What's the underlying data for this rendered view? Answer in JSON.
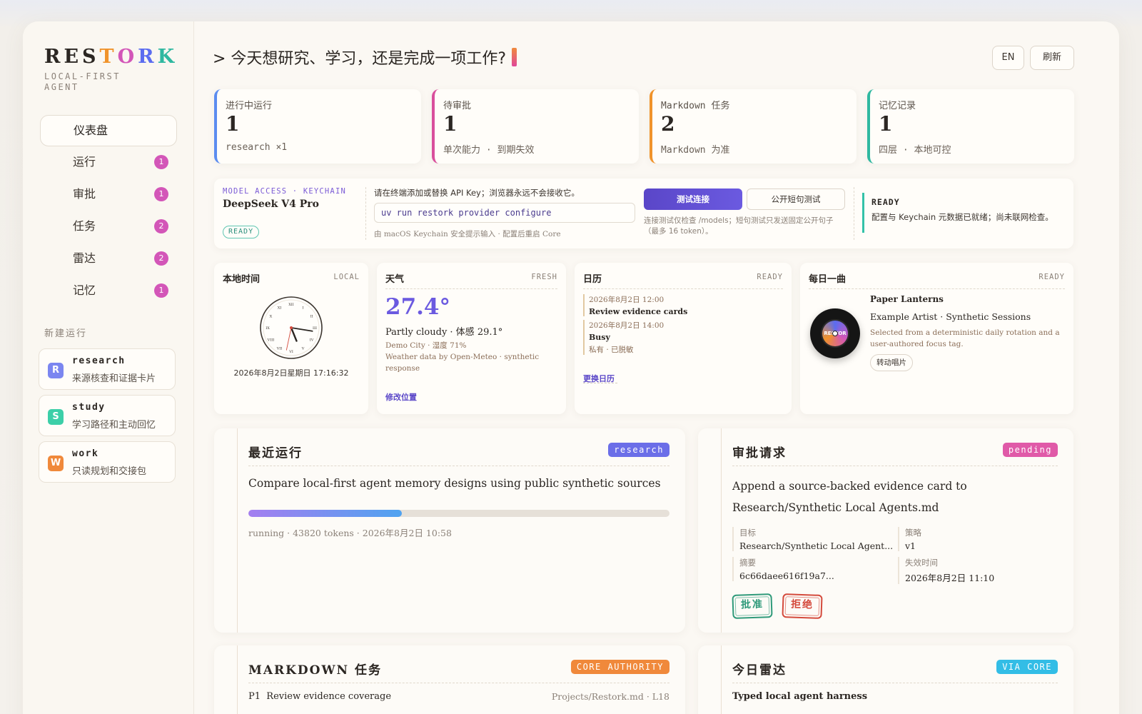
{
  "logo": {
    "letters": [
      {
        "ch": "R",
        "color": "#2b2622"
      },
      {
        "ch": "E",
        "color": "#2b2622"
      },
      {
        "ch": "S",
        "color": "#2b2622"
      },
      {
        "ch": "T",
        "color": "#f0932b"
      },
      {
        "ch": "O",
        "color": "#d356b8"
      },
      {
        "ch": "R",
        "color": "#5b6cf0"
      },
      {
        "ch": "K",
        "color": "#2fb8a0"
      }
    ],
    "tagline": "LOCAL-FIRST AGENT"
  },
  "nav": {
    "active": "仪表盘",
    "items": [
      {
        "label": "运行",
        "count": "1"
      },
      {
        "label": "审批",
        "count": "1"
      },
      {
        "label": "任务",
        "count": "2"
      },
      {
        "label": "雷达",
        "count": "2"
      },
      {
        "label": "记忆",
        "count": "1"
      }
    ]
  },
  "new_run": {
    "label": "新建运行",
    "items": [
      {
        "letter": "R",
        "name": "research",
        "desc": "来源核查和证据卡片",
        "color": "#7b86f0"
      },
      {
        "letter": "S",
        "name": "study",
        "desc": "学习路径和主动回忆",
        "color": "#3ccfa8"
      },
      {
        "letter": "W",
        "name": "work",
        "desc": "只读规划和交接包",
        "color": "#f0893b"
      }
    ]
  },
  "header": {
    "prompt": "> 今天想研究、学习，还是完成一项工作?",
    "lang_button": "EN",
    "refresh_button": "刷新"
  },
  "stats": [
    {
      "label": "进行中运行",
      "value": "1",
      "sub": "research ×1",
      "color": "#5b8cf0"
    },
    {
      "label": "待审批",
      "value": "1",
      "sub": "单次能力 · 到期失效",
      "color": "#d94f9c"
    },
    {
      "label": "Markdown 任务",
      "value": "2",
      "sub": "Markdown 为准",
      "color": "#f0932b"
    },
    {
      "label": "记忆记录",
      "value": "1",
      "sub": "四层 · 本地可控",
      "color": "#2fb8a0"
    }
  ],
  "model_access": {
    "kicker": "MODEL ACCESS · KEYCHAIN",
    "model": "DeepSeek V4 Pro",
    "badge": "READY",
    "instruction": "请在终端添加或替换 API Key；浏览器永远不会接收它。",
    "command": "uv run restork provider configure",
    "hint": "由 macOS Keychain 安全提示输入 · 配置后重启 Core",
    "test_button": "测试连接",
    "public_test_button": "公开短句测试",
    "test_note": "连接测试仅检查 /models；短句测试只发送固定公开句子（最多 16 token）。",
    "status_title": "READY",
    "status_text": "配置与 Keychain 元数据已就绪；尚未联网检查。"
  },
  "clock": {
    "title": "本地时间",
    "tag": "LOCAL",
    "datetime": "2026年8月2日星期日 17:16:32",
    "hour": 17,
    "minute": 16,
    "second": 32,
    "numerals": [
      "XII",
      "I",
      "II",
      "III",
      "IV",
      "V",
      "VI",
      "VII",
      "VIII",
      "IX",
      "X",
      "XI"
    ]
  },
  "weather": {
    "title": "天气",
    "tag": "FRESH",
    "temp": "27.4°",
    "summary": "Partly cloudy · 体感 29.1°",
    "location": "Demo City · 湿度 71%",
    "credit": "Weather data by Open-Meteo · synthetic response",
    "link": "修改位置"
  },
  "calendar": {
    "title": "日历",
    "tag": "READY",
    "events": [
      {
        "time": "2026年8月2日 12:00",
        "name": "Review evidence cards",
        "note": ""
      },
      {
        "time": "2026年8月2日 14:00",
        "name": "Busy",
        "note": "私有 · 已脱敏"
      }
    ],
    "link": "更换日历"
  },
  "song": {
    "title": "每日一曲",
    "tag": "READY",
    "song_title": "Paper Lanterns",
    "artist": "Example Artist · Synthetic Sessions",
    "desc": "Selected from a deterministic daily rotation and a user-authored focus tag.",
    "button": "转动唱片",
    "disc_label": "RESTOR"
  },
  "recent_run": {
    "title": "最近运行",
    "pill": "research",
    "description": "Compare local-first agent memory designs using public synthetic sources",
    "progress": 0.365,
    "meta": "running · 43820 tokens · 2026年8月2日 10:58"
  },
  "approval": {
    "title": "审批请求",
    "pill": "pending",
    "request": "Append a source-backed evidence card to Research/Synthetic Local Agents.md",
    "fields": {
      "target_label": "目标",
      "target_value": "Research/Synthetic Local Agent...",
      "policy_label": "策略",
      "policy_value": "v1",
      "digest_label": "摘要",
      "digest_value": "6c66daee616f19a7...",
      "expiry_label": "失效时间",
      "expiry_value": "2026年8月2日 11:10"
    },
    "approve": "批准",
    "reject": "拒绝"
  },
  "markdown_tasks": {
    "title": "MARKDOWN 任务",
    "pill": "CORE AUTHORITY",
    "first_item": "P1  Review evidence coverage",
    "first_path": "Projects/Restork.md · L18"
  },
  "radar": {
    "title": "今日雷达",
    "pill": "VIA CORE",
    "first_item": "Typed local agent harness"
  }
}
